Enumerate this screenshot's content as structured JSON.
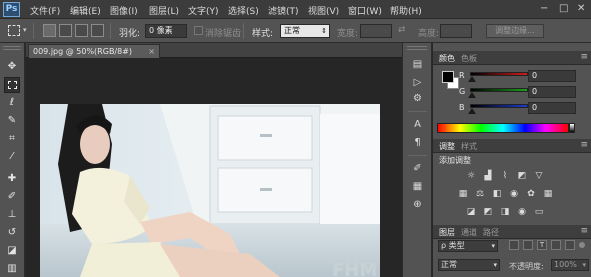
{
  "app": {
    "logo": "Ps",
    "accent": "#6fa7d8"
  },
  "menu": [
    "文件(F)",
    "编辑(E)",
    "图像(I)",
    "图层(L)",
    "文字(Y)",
    "选择(S)",
    "滤镜(T)",
    "视图(V)",
    "窗口(W)",
    "帮助(H)"
  ],
  "window_controls": {
    "minimize": "−",
    "maximize": "□",
    "close": "✕"
  },
  "options": {
    "feather_label": "羽化:",
    "feather_value": "0 像素",
    "antialias_label": "消除锯齿",
    "style_label": "样式:",
    "style_value": "正常",
    "width_label": "宽度:",
    "height_label": "高度:",
    "refine_edge": "调整边缘..."
  },
  "document": {
    "tab_title": "009.jpg @ 50%(RGB/8#)",
    "close": "×",
    "watermark": "FHM"
  },
  "color_panel": {
    "tab_active": "颜色",
    "tab_other": "色板",
    "r_label": "R",
    "g_label": "G",
    "b_label": "B",
    "r_value": "0",
    "g_value": "0",
    "b_value": "0",
    "foreground": "#000000",
    "background": "#ffffff"
  },
  "adjust_panel": {
    "tab_active": "调整",
    "tab_other": "样式",
    "title": "添加调整"
  },
  "layers_panel": {
    "tabs": [
      "图层",
      "通道",
      "路径"
    ],
    "kind_label": "ρ 类型",
    "blend_mode": "正常",
    "opacity_label": "不透明度:",
    "opacity_value": "100%"
  }
}
